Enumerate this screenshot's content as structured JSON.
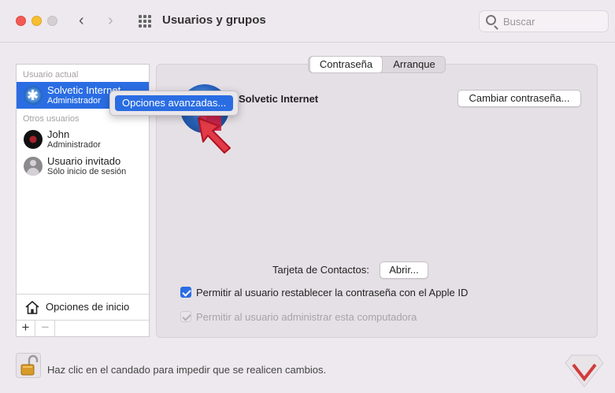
{
  "window": {
    "title": "Usuarios y grupos"
  },
  "search": {
    "placeholder": "Buscar"
  },
  "sidebar": {
    "current_user_label": "Usuario actual",
    "other_users_label": "Otros usuarios",
    "users": [
      {
        "name": "Solvetic Internet",
        "role": "Administrador",
        "selected": true,
        "avatar": "snowflake-avatar"
      },
      {
        "name": "John",
        "role": "Administrador",
        "selected": false,
        "avatar": "record-avatar"
      },
      {
        "name": "Usuario invitado",
        "role": "Sólo inicio de sesión",
        "selected": false,
        "avatar": "guest-avatar"
      }
    ],
    "login_options_label": "Opciones de inicio",
    "add_label": "+",
    "remove_label": "−"
  },
  "context_menu": {
    "items": [
      {
        "label": "Opciones avanzadas..."
      }
    ]
  },
  "tabs": [
    {
      "label": "Contraseña",
      "active": true
    },
    {
      "label": "Arranque",
      "active": false
    }
  ],
  "main": {
    "user_full_name": "Solvetic Internet",
    "change_password_label": "Cambiar contraseña...",
    "contacts_card_label": "Tarjeta de Contactos:",
    "open_label": "Abrir...",
    "allow_reset_label": "Permitir al usuario restablecer la contraseña con el Apple ID",
    "allow_reset_checked": true,
    "allow_admin_label": "Permitir al usuario administrar esta computadora",
    "allow_admin_checked": true,
    "allow_admin_disabled": true
  },
  "footer": {
    "lock_text": "Haz clic en el candado para impedir que se realicen cambios."
  },
  "colors": {
    "accent": "#2a6de3",
    "window_bg": "#eee9ee"
  }
}
